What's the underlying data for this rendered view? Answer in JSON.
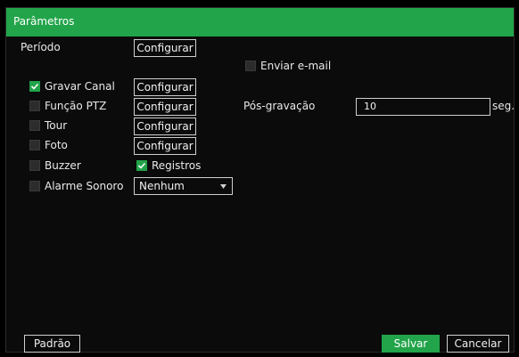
{
  "dialog": {
    "title": "Parâmetros"
  },
  "periodo": {
    "label": "Período",
    "button": "Configurar"
  },
  "enviar_email": {
    "label": "Enviar e-mail",
    "checked": false
  },
  "rows": [
    {
      "key": "gravar",
      "label": "Gravar Canal",
      "checked": true,
      "button": "Configurar"
    },
    {
      "key": "ptz",
      "label": "Função PTZ",
      "checked": false,
      "button": "Configurar"
    },
    {
      "key": "tour",
      "label": "Tour",
      "checked": false,
      "button": "Configurar"
    },
    {
      "key": "foto",
      "label": "Foto",
      "checked": false,
      "button": "Configurar"
    },
    {
      "key": "buzzer",
      "label": "Buzzer",
      "checked": false
    },
    {
      "key": "alarme",
      "label": "Alarme Sonoro",
      "checked": false
    }
  ],
  "registros": {
    "label": "Registros",
    "checked": true
  },
  "alarme_select": {
    "value": "Nenhum"
  },
  "pos_gravacao": {
    "label": "Pós-gravação",
    "value": "10",
    "unit": "seg."
  },
  "footer": {
    "default_label": "Padrão",
    "save_label": "Salvar",
    "cancel_label": "Cancelar"
  },
  "colors": {
    "accent": "#22a44a",
    "background": "#0b0b0b"
  }
}
